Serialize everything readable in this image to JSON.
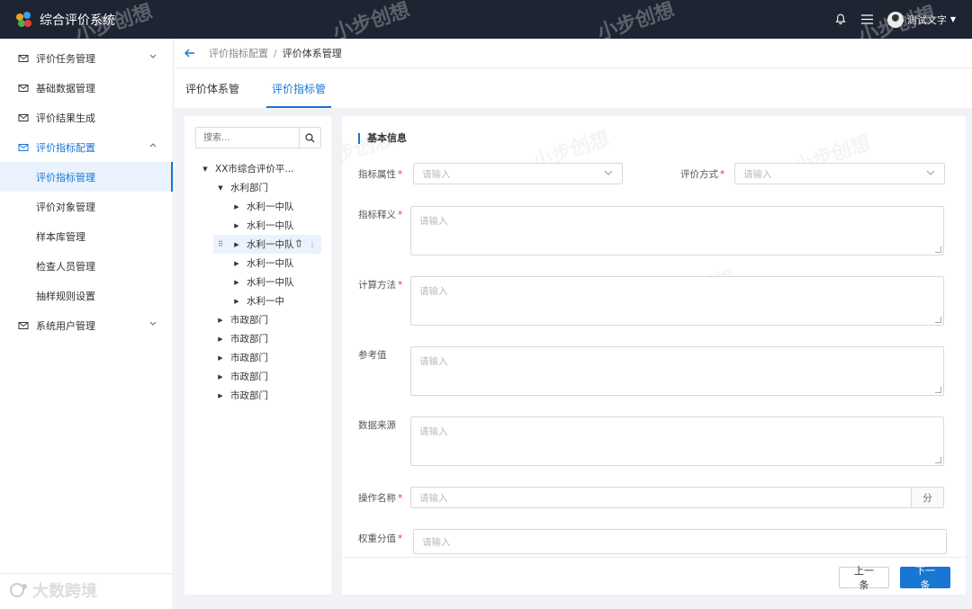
{
  "app": {
    "title": "综合评价系统",
    "user_name": "测试文字"
  },
  "colors": {
    "topbar": "#1e2432",
    "accent": "#1976d2",
    "required": "#e53935"
  },
  "watermark": {
    "text": "小步创想",
    "footer_text": "大数跨境"
  },
  "sidebar": {
    "items": [
      {
        "label": "评价任务管理",
        "icon": "mail-icon",
        "chevron": "⌄"
      },
      {
        "label": "基础数据管理",
        "icon": "mail-icon"
      },
      {
        "label": "评价结果生成",
        "icon": "mail-icon"
      },
      {
        "label": "评价指标配置",
        "icon": "mail-icon",
        "chevron": "⌃"
      },
      {
        "label": "评价指标管理"
      },
      {
        "label": "评价对象管理"
      },
      {
        "label": "样本库管理"
      },
      {
        "label": "检查人员管理"
      },
      {
        "label": "抽样规则设置"
      },
      {
        "label": "系统用户管理",
        "icon": "mail-icon",
        "chevron": "⌄"
      }
    ]
  },
  "breadcrumb": {
    "parent": "评价指标配置",
    "separator": "/",
    "current": "评价体系管理"
  },
  "tabs": [
    {
      "label": "评价体系管"
    },
    {
      "label": "评价指标管"
    }
  ],
  "tree": {
    "search_placeholder": "搜索...",
    "nodes": [
      {
        "label": "XX市综合评价平...",
        "tri": "▼"
      },
      {
        "label": "水利部门",
        "tri": "▼"
      },
      {
        "label": "水利一中队",
        "tri": "▶"
      },
      {
        "label": "水利一中队",
        "tri": "▶"
      },
      {
        "label": "水利一中队",
        "tri": "▶"
      },
      {
        "label": "水利一中队",
        "tri": "▶"
      },
      {
        "label": "水利一中队",
        "tri": "▶"
      },
      {
        "label": "水利一中",
        "tri": "▶"
      },
      {
        "label": "市政部门",
        "tri": "▶"
      },
      {
        "label": "市政部门",
        "tri": "▶"
      },
      {
        "label": "市政部门",
        "tri": "▶"
      },
      {
        "label": "市政部门",
        "tri": "▶"
      },
      {
        "label": "市政部门",
        "tri": "▶"
      }
    ]
  },
  "form": {
    "section_title": "基本信息",
    "required_mark": "*",
    "fields": {
      "attr": {
        "label": "指标属性",
        "placeholder": "请输入"
      },
      "method": {
        "label": "评价方式",
        "placeholder": "请输入"
      },
      "definition": {
        "label": "指标释义",
        "placeholder": "请输入"
      },
      "calc": {
        "label": "计算方法",
        "placeholder": "请输入"
      },
      "reference": {
        "label": "参考值",
        "placeholder": "请输入"
      },
      "source": {
        "label": "数据来源",
        "placeholder": "请输入"
      },
      "op_name": {
        "label": "操作名称",
        "placeholder": "请输入",
        "suffix": "分"
      },
      "weight": {
        "label": "权重分值",
        "placeholder": "请输入"
      }
    }
  },
  "buttons": {
    "prev": "上一条",
    "next": "下一条"
  }
}
